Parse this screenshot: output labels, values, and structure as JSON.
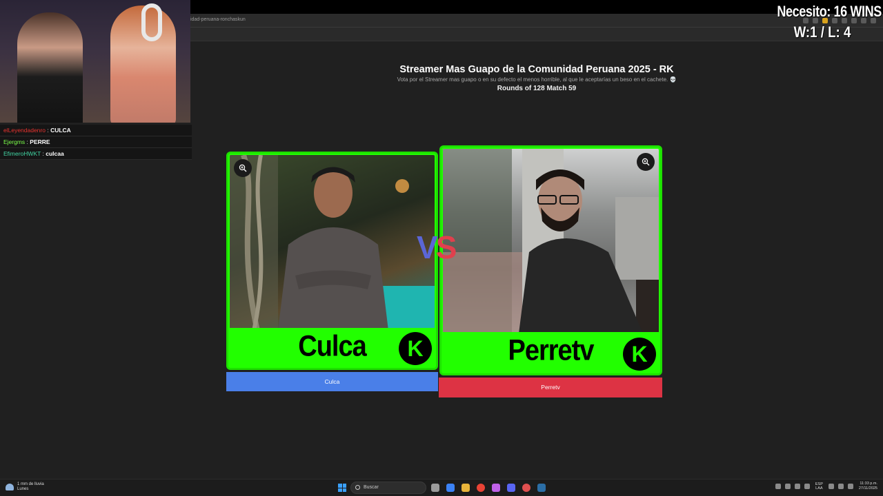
{
  "browser": {
    "url_fragment": "idad-peruana-ronchaskun"
  },
  "page": {
    "title": "Streamer Mas Guapo de la Comunidad Peruana 2025 - RK",
    "subtitle": "Vota por el Streamer mas guapo o en su defecto el menos horrible, al que le aceptarías un beso en el cachete. 💀",
    "rounds": "Rounds of 128 Match 59",
    "vs_v": "V",
    "vs_s": "S"
  },
  "contestants": {
    "left": {
      "name": "Culca",
      "logo": "K",
      "vote_label": "Culca"
    },
    "right": {
      "name": "Perretv",
      "logo": "K",
      "vote_label": "Perretv"
    }
  },
  "overlay": {
    "stats_needed": "Necesito: 16 WINS",
    "stats_record": "W:1 / L: 4",
    "chat": [
      {
        "user": "elLeyendadenro",
        "text": "CULCA",
        "color": "#e8332f"
      },
      {
        "user": "Ejergms",
        "text": "PERRE",
        "color": "#7cff4a"
      },
      {
        "user": "EfimeroHWKT",
        "text": "culcaa",
        "color": "#42d6a4"
      }
    ]
  },
  "taskbar": {
    "weather_temp": "1 mm de lluvia",
    "weather_day": "Lunes",
    "search_placeholder": "Buscar",
    "lang_1": "ESP",
    "lang_2": "LAA",
    "time": "11:33 p.m.",
    "date": "27/11/2025"
  },
  "colors": {
    "card_green": "#22ff00",
    "vote_blue": "#4a7fe8",
    "vote_red": "#dd3344",
    "page_bg": "#202020"
  }
}
